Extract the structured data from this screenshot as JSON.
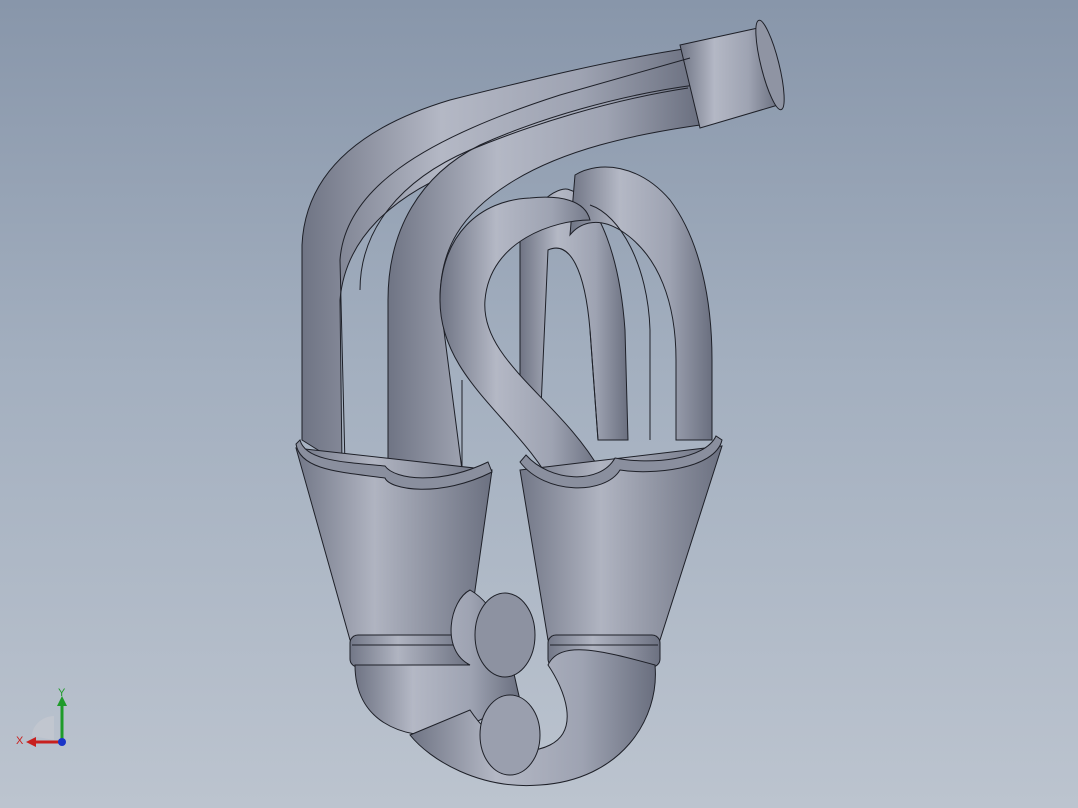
{
  "viewport": {
    "background_top": "#8896aa",
    "background_bottom": "#bcc4cf",
    "model_color": "#a1a6b5",
    "model_shadow": "#6e7383",
    "edge_color": "#1e2028"
  },
  "triad": {
    "x_label": "X",
    "y_label": "Y",
    "x_color": "#c8201e",
    "y_color": "#1f9b2a",
    "z_color": "#1a35c8"
  }
}
